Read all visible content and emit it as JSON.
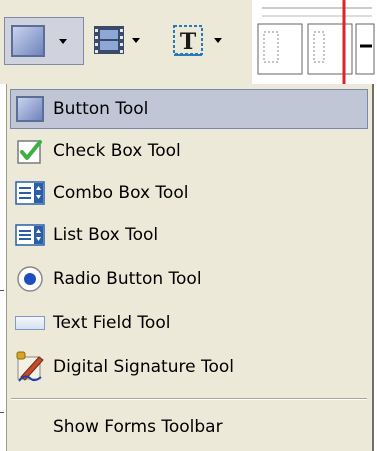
{
  "menu": {
    "items": [
      {
        "label": "Button Tool",
        "icon": "button-tool-icon",
        "highlighted": true
      },
      {
        "label": "Check Box Tool",
        "icon": "check-box-icon",
        "highlighted": false
      },
      {
        "label": "Combo Box Tool",
        "icon": "combo-box-icon",
        "highlighted": false
      },
      {
        "label": "List Box Tool",
        "icon": "list-box-icon",
        "highlighted": false
      },
      {
        "label": "Radio Button Tool",
        "icon": "radio-button-icon",
        "highlighted": false
      },
      {
        "label": "Text Field Tool",
        "icon": "text-field-icon",
        "highlighted": false
      },
      {
        "label": "Digital Signature Tool",
        "icon": "digital-signature-icon",
        "highlighted": false
      }
    ],
    "footer_label": "Show Forms Toolbar"
  },
  "colors": {
    "menu_bg": "#ece9d8",
    "highlight_bg": "#c1c6d6",
    "highlight_border": "#7a88ab",
    "check_green": "#3cb043",
    "radio_blue": "#1f4fbf",
    "doc_red_line": "#e0202a"
  }
}
